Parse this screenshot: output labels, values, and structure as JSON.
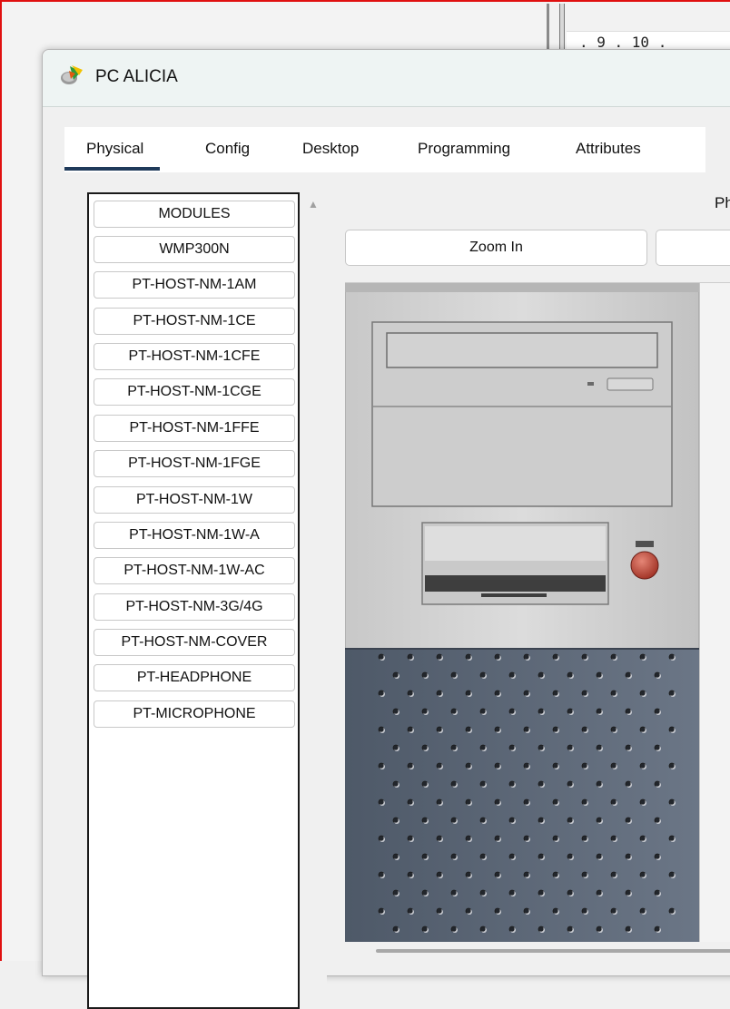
{
  "background": {
    "ruler_text": ". 9 . 10 ."
  },
  "window": {
    "title": "PC ALICIA",
    "icon": "packet-tracer-pc-icon"
  },
  "tabs": [
    {
      "label": "Physical",
      "active": true
    },
    {
      "label": "Config",
      "active": false
    },
    {
      "label": "Desktop",
      "active": false
    },
    {
      "label": "Programming",
      "active": false
    },
    {
      "label": "Attributes",
      "active": false
    }
  ],
  "modules": {
    "items": [
      "MODULES",
      "WMP300N",
      "PT-HOST-NM-1AM",
      "PT-HOST-NM-1CE",
      "PT-HOST-NM-1CFE",
      "PT-HOST-NM-1CGE",
      "PT-HOST-NM-1FFE",
      "PT-HOST-NM-1FGE",
      "PT-HOST-NM-1W",
      "PT-HOST-NM-1W-A",
      "PT-HOST-NM-1W-AC",
      "PT-HOST-NM-3G/4G",
      "PT-HOST-NM-COVER",
      "PT-HEADPHONE",
      "PT-MICROPHONE"
    ]
  },
  "physical_view": {
    "header_partial": "Ph",
    "zoom_in_label": "Zoom In",
    "zoom_second_label": ""
  },
  "colors": {
    "frame_border": "#e01010",
    "active_tab_underline": "#1f3a5a",
    "tower_grille": "#5a6575",
    "power_button": "#c0392b"
  }
}
